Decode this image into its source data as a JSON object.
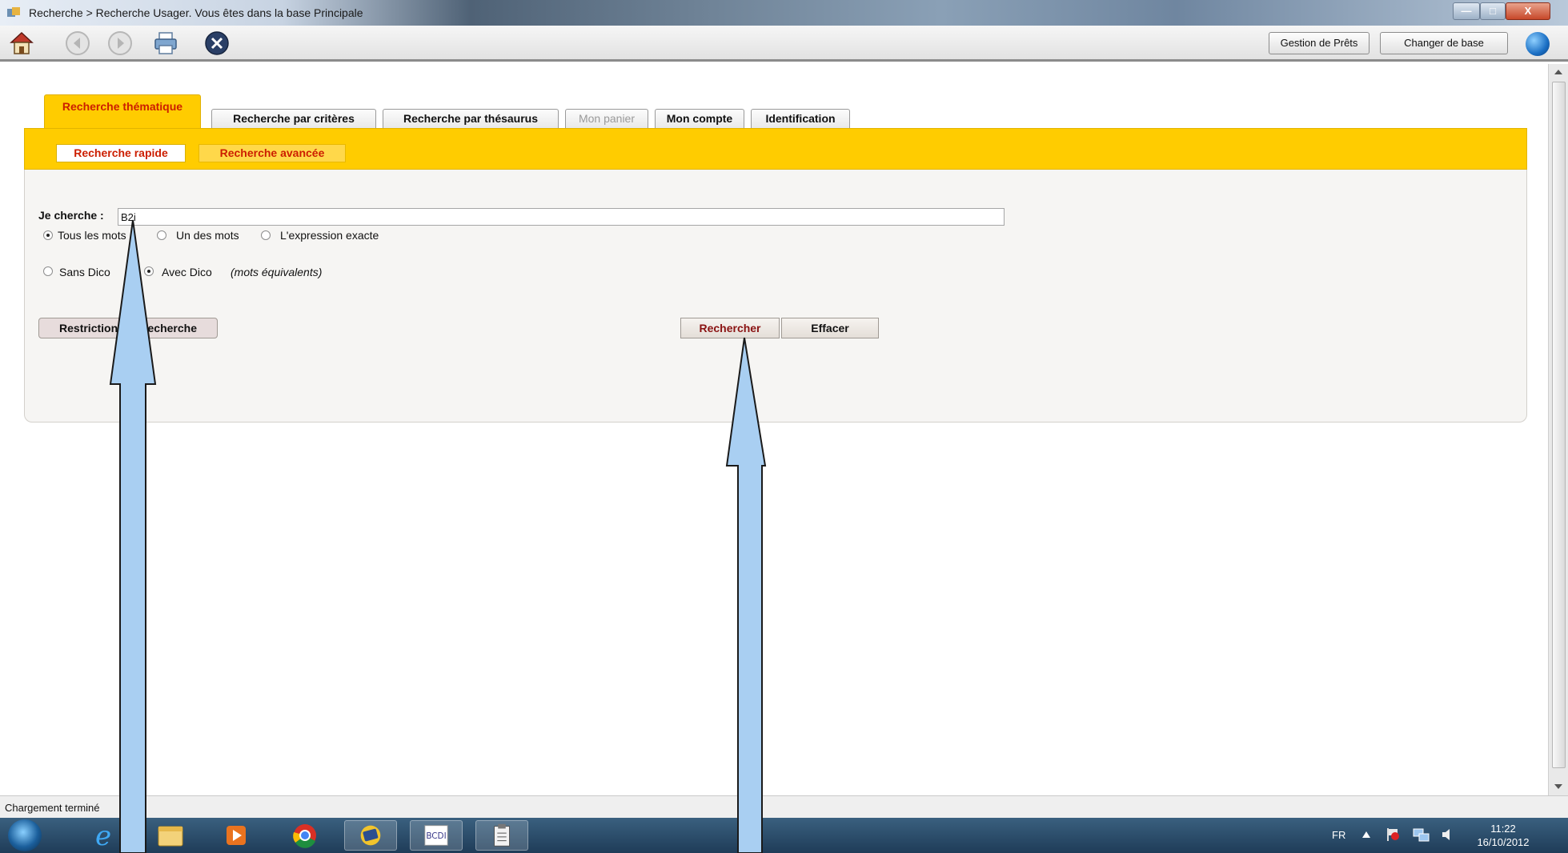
{
  "window": {
    "title": "Recherche > Recherche Usager.  Vous êtes dans la base Principale",
    "minimize_label": "—",
    "maximize_label": "□",
    "close_label": "X"
  },
  "toolbar": {
    "icons": [
      "home-icon",
      "back-icon",
      "forward-icon",
      "print-icon",
      "close-circle-icon"
    ],
    "gestion_prets_label": "Gestion de Prêts",
    "changer_base_label": "Changer de base",
    "globe_icon": "globe-icon"
  },
  "tabs": [
    {
      "label": "Recherche thématique",
      "state": "active"
    },
    {
      "label": "Recherche par critères",
      "state": "normal"
    },
    {
      "label": "Recherche par thésaurus",
      "state": "normal"
    },
    {
      "label": "Mon panier",
      "state": "disabled"
    },
    {
      "label": "Mon compte",
      "state": "normal"
    },
    {
      "label": "Identification",
      "state": "normal"
    }
  ],
  "subtabs": [
    {
      "label": "Recherche rapide",
      "state": "active"
    },
    {
      "label": "Recherche avancée",
      "state": "inactive"
    }
  ],
  "form": {
    "search_label": "Je cherche :",
    "search_value": "B2i",
    "match_options": [
      {
        "label": "Tous les mots",
        "selected": true
      },
      {
        "label": "Un des mots",
        "selected": false
      },
      {
        "label": "L'expression exacte",
        "selected": false
      }
    ],
    "dico_options": [
      {
        "label": "Sans Dico",
        "selected": false
      },
      {
        "label": "Avec Dico",
        "selected": true
      }
    ],
    "dico_note": "(mots équivalents)",
    "restrictions_label": "Restrictions de recherche",
    "search_button": "Rechercher",
    "clear_button": "Effacer"
  },
  "status": {
    "text": "Chargement terminé"
  },
  "taskbar": {
    "apps": [
      "windows-start-icon",
      "internet-explorer-icon",
      "file-explorer-icon",
      "media-player-icon",
      "chrome-icon",
      "bcdi-book-icon",
      "bcdi-app-icon",
      "clipboard-icon"
    ],
    "language": "FR",
    "time": "11:22",
    "date": "16/10/2012"
  },
  "colors": {
    "accent_yellow": "#ffcc00",
    "accent_red": "#cc1e00",
    "overlay_arrow": "#a9cff2"
  }
}
